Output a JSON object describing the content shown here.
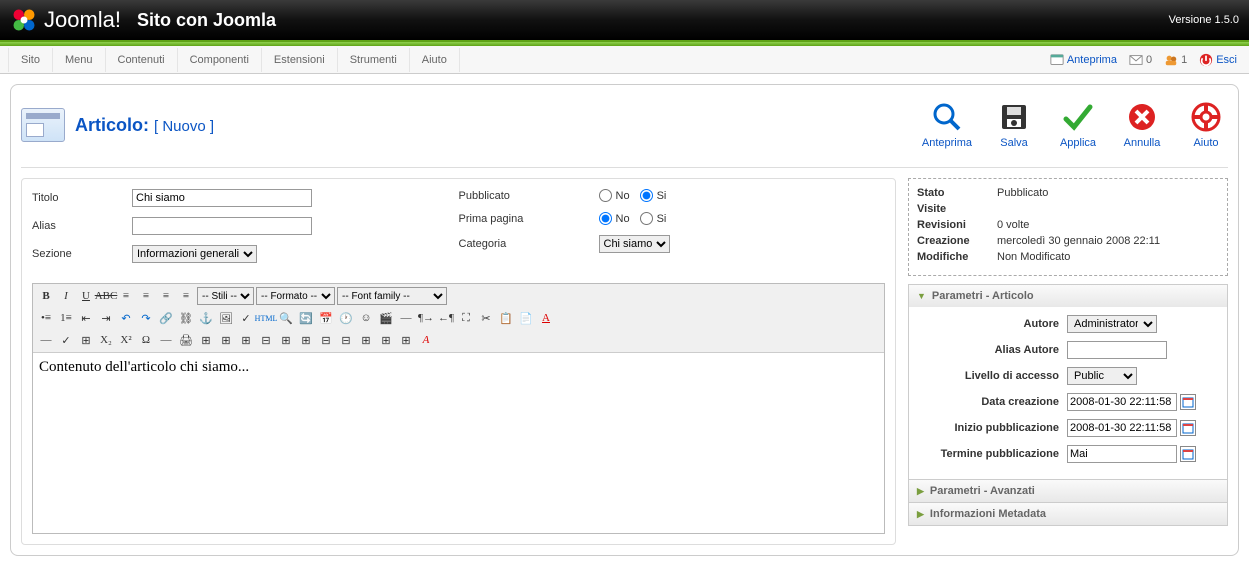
{
  "topbar": {
    "brand": "Joomla!",
    "site_title": "Sito con Joomla",
    "version": "Versione 1.5.0"
  },
  "menubar": {
    "items": [
      "Sito",
      "Menu",
      "Contenuti",
      "Componenti",
      "Estensioni",
      "Strumenti",
      "Aiuto"
    ],
    "preview": "Anteprima",
    "msg_count": "0",
    "user_count": "1",
    "logout": "Esci"
  },
  "page": {
    "heading": "Articolo:",
    "heading_sub": "[ Nuovo ]"
  },
  "toolbar": {
    "preview": "Anteprima",
    "save": "Salva",
    "apply": "Applica",
    "cancel": "Annulla",
    "help": "Aiuto"
  },
  "fields": {
    "title_label": "Titolo",
    "title_value": "Chi siamo",
    "alias_label": "Alias",
    "alias_value": "",
    "section_label": "Sezione",
    "section_value": "Informazioni generali",
    "published_label": "Pubblicato",
    "frontpage_label": "Prima pagina",
    "category_label": "Categoria",
    "category_value": "Chi siamo",
    "no": "No",
    "si": "Si"
  },
  "editor": {
    "style_sel": "-- Stili --",
    "format_sel": "-- Formato --",
    "font_sel": "-- Font family --",
    "content": "Contenuto dell'articolo chi siamo..."
  },
  "info": {
    "state_k": "Stato",
    "state_v": "Pubblicato",
    "hits_k": "Visite",
    "hits_v": "",
    "rev_k": "Revisioni",
    "rev_v": "0 volte",
    "created_k": "Creazione",
    "created_v": "mercoledì 30 gennaio 2008 22:11",
    "mod_k": "Modifiche",
    "mod_v": "Non Modificato"
  },
  "panels": {
    "article": {
      "title": "Parametri - Articolo",
      "author_label": "Autore",
      "author_value": "Administrator",
      "author_alias_label": "Alias Autore",
      "author_alias_value": "",
      "access_label": "Livello di accesso",
      "access_value": "Public",
      "created_label": "Data creazione",
      "created_value": "2008-01-30 22:11:58",
      "pubstart_label": "Inizio pubblicazione",
      "pubstart_value": "2008-01-30 22:11:58",
      "pubend_label": "Termine pubblicazione",
      "pubend_value": "Mai"
    },
    "advanced": {
      "title": "Parametri - Avanzati"
    },
    "metadata": {
      "title": "Informazioni Metadata"
    }
  }
}
